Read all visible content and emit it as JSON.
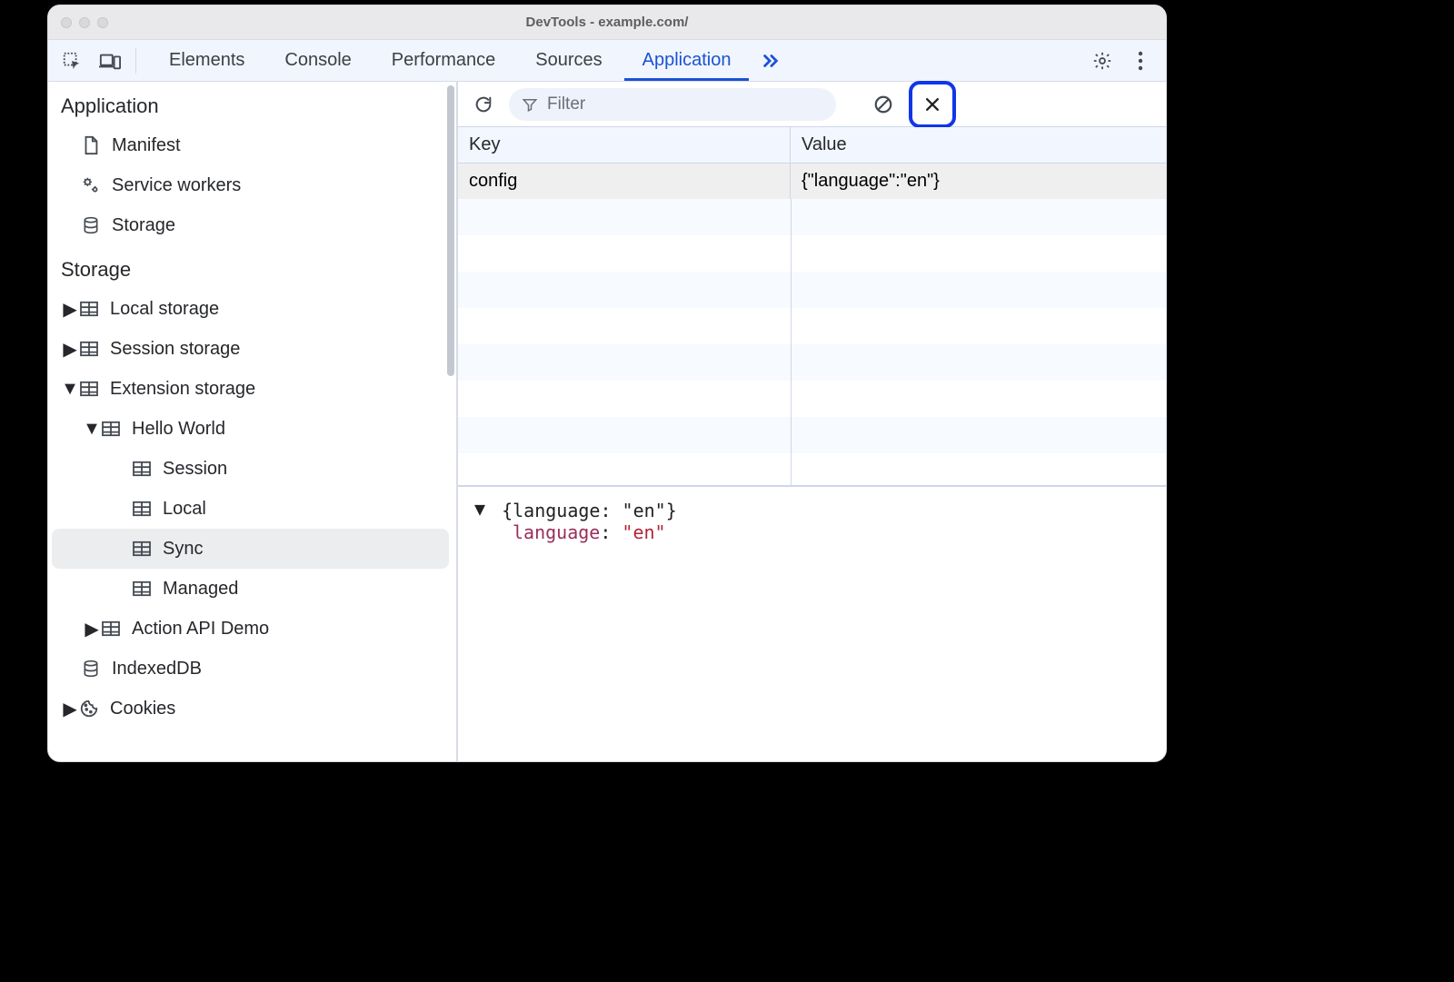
{
  "window": {
    "title": "DevTools - example.com/"
  },
  "tabs": {
    "items": [
      "Elements",
      "Console",
      "Performance",
      "Sources",
      "Application"
    ],
    "active": "Application"
  },
  "sidebar": {
    "sections": [
      {
        "title": "Application",
        "items": [
          {
            "label": "Manifest",
            "icon": "file"
          },
          {
            "label": "Service workers",
            "icon": "gears"
          },
          {
            "label": "Storage",
            "icon": "database"
          }
        ]
      },
      {
        "title": "Storage",
        "items": [
          {
            "label": "Local storage",
            "icon": "table",
            "expandable": true,
            "expanded": false
          },
          {
            "label": "Session storage",
            "icon": "table",
            "expandable": true,
            "expanded": false
          },
          {
            "label": "Extension storage",
            "icon": "table",
            "expandable": true,
            "expanded": true,
            "children": [
              {
                "label": "Hello World",
                "icon": "table",
                "expandable": true,
                "expanded": true,
                "children": [
                  {
                    "label": "Session",
                    "icon": "table"
                  },
                  {
                    "label": "Local",
                    "icon": "table"
                  },
                  {
                    "label": "Sync",
                    "icon": "table",
                    "selected": true
                  },
                  {
                    "label": "Managed",
                    "icon": "table"
                  }
                ]
              },
              {
                "label": "Action API Demo",
                "icon": "table",
                "expandable": true,
                "expanded": false
              }
            ]
          },
          {
            "label": "IndexedDB",
            "icon": "database"
          },
          {
            "label": "Cookies",
            "icon": "cookie",
            "expandable": true,
            "expanded": false
          }
        ]
      }
    ]
  },
  "toolbar": {
    "filter_placeholder": "Filter"
  },
  "table": {
    "columns": {
      "key": "Key",
      "value": "Value"
    },
    "rows": [
      {
        "key": "config",
        "value": "{\"language\":\"en\"}"
      }
    ]
  },
  "preview": {
    "summary": "{language: \"en\"}",
    "prop_key": "language",
    "prop_sep": ": ",
    "prop_val": "\"en\""
  }
}
